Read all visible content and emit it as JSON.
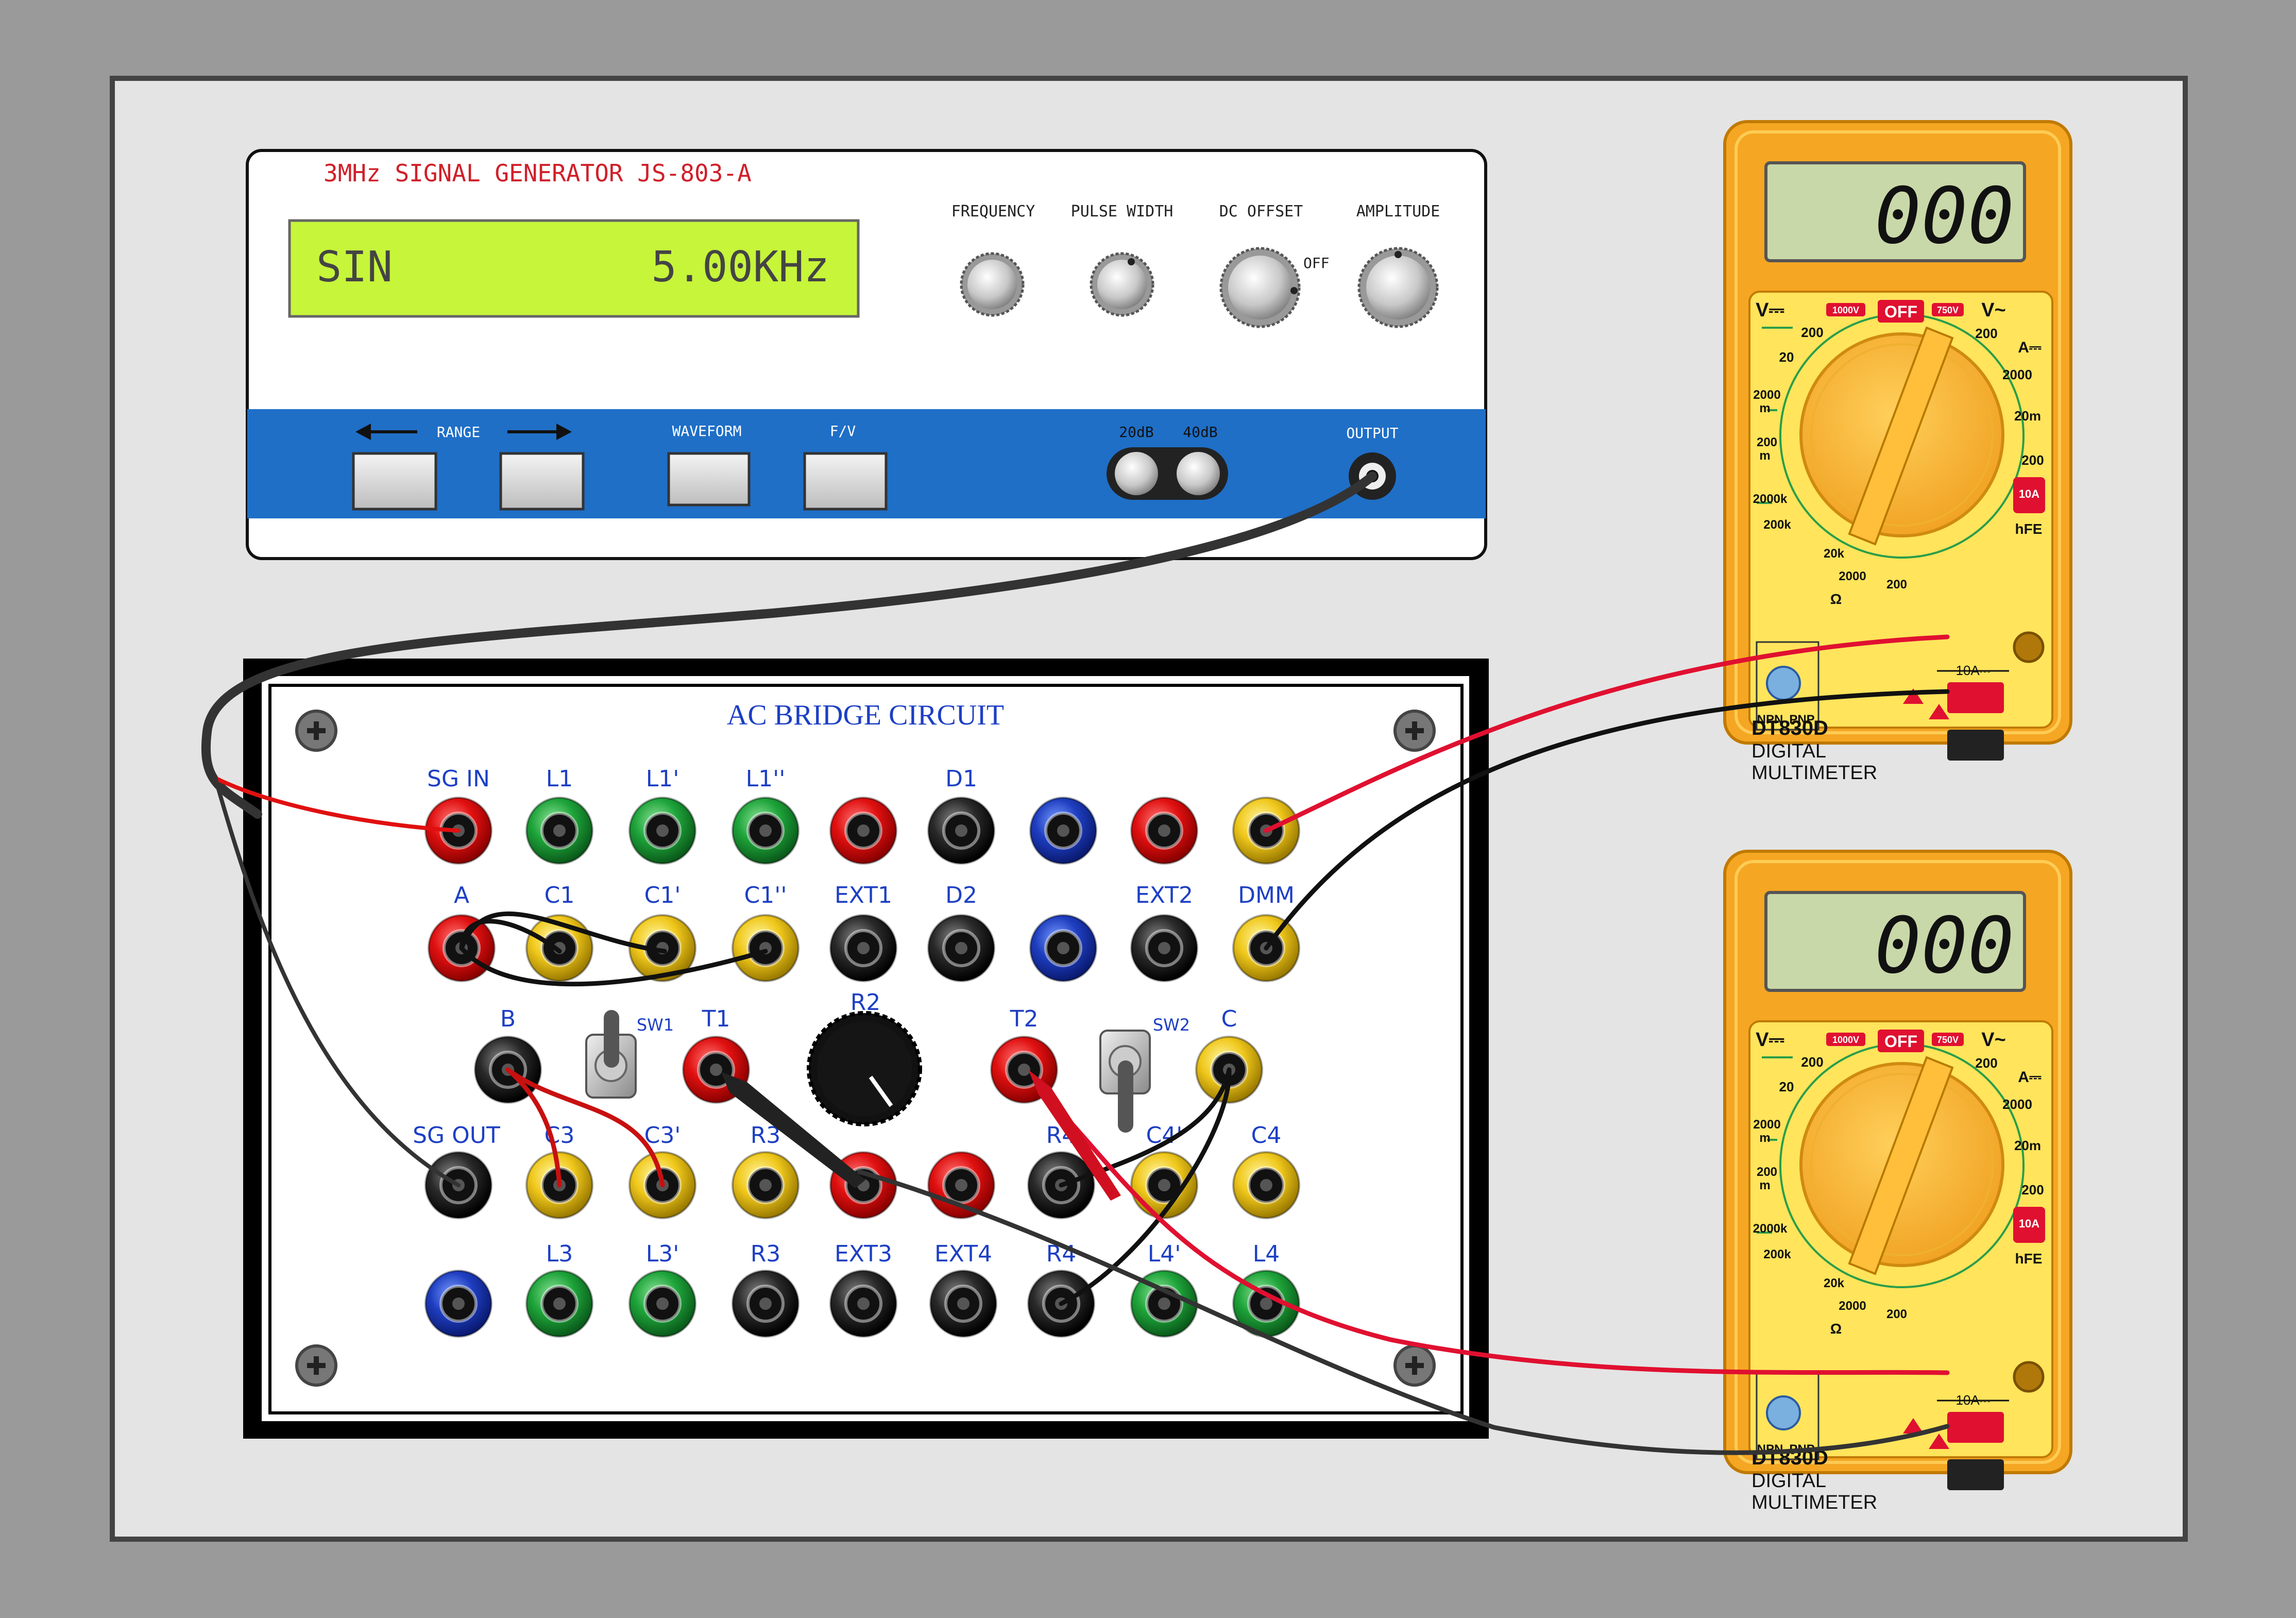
{
  "signal_generator": {
    "title": "3MHz SIGNAL GENERATOR JS-803-A",
    "display_mode": "SIN",
    "display_freq": "5.00KHz",
    "knobs": [
      "FREQUENCY",
      "PULSE WIDTH",
      "DC OFFSET",
      "AMPLITUDE"
    ],
    "dc_offset_off": "OFF",
    "range_label": "RANGE",
    "waveform_label": "WAVEFORM",
    "fv_label": "F/V",
    "att_20": "20dB",
    "att_40": "40dB",
    "output_label": "OUTPUT"
  },
  "board": {
    "title": "AC BRIDGE CIRCUIT",
    "row1_labels": [
      "SG IN",
      "L1",
      "L1'",
      "L1''",
      "D1"
    ],
    "row2_labels": [
      "A",
      "C1",
      "C1'",
      "C1''",
      "EXT1",
      "D2",
      "EXT2",
      "DMM"
    ],
    "row3_labels": [
      "B",
      "SW1",
      "T1",
      "R2",
      "T2",
      "SW2",
      "C"
    ],
    "row4_labels": [
      "SG OUT",
      "C3",
      "C3'",
      "R3",
      "R4",
      "C4'",
      "C4"
    ],
    "row5_labels": [
      "L3",
      "L3'",
      "R3",
      "EXT3",
      "EXT4",
      "R4",
      "L4'",
      "L4"
    ]
  },
  "multimeters": [
    {
      "reading": "000",
      "model": "DT830D",
      "line1": "DIGITAL",
      "line2": "MULTIMETER"
    },
    {
      "reading": "000",
      "model": "DT830D",
      "line1": "DIGITAL",
      "line2": "MULTIMETER"
    }
  ],
  "dial_labels": {
    "v_dc": "V⎓",
    "v_ac": "V~",
    "off": "OFF",
    "v1000": "1000V",
    "v750": "750V",
    "a_dc": "A⎓",
    "v200a": "200",
    "v20": "20",
    "v2000m": "2000",
    "m": "m",
    "v200m": "200",
    "ac200": "200",
    "a2000": "2000",
    "a20m": "20m",
    "a200": "200",
    "ten_a": "10A",
    "r2000k": "2000k",
    "r200k": "200k",
    "r20k": "20k",
    "r2000": "2000",
    "r200": "200",
    "hfe": "hFE",
    "ohm": "Ω",
    "npn": "NPN",
    "pnp": "PNP",
    "ten_a_port": "10A⎓"
  },
  "colors": {
    "panel": "#e4e4e4",
    "lcd_green": "#c6f53a",
    "gen_blue": "#1f6fc7",
    "meter_orange": "#f5a623",
    "meter_yellow": "#ffe45c",
    "title_red": "#d0202a",
    "board_blue": "#1d3fc4"
  }
}
